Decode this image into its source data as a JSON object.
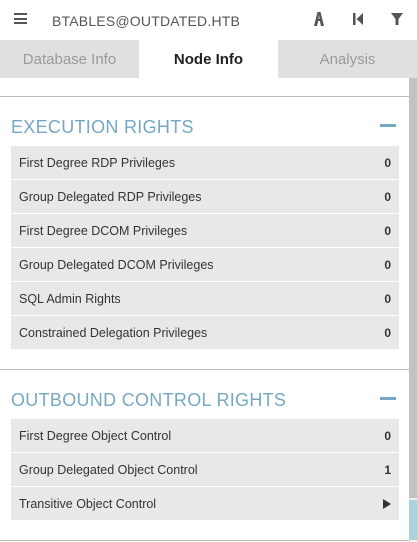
{
  "header": {
    "node_name": "BTABLES@OUTDATED.HTB",
    "icons": [
      "menu-icon",
      "pathfinding-icon",
      "back-icon",
      "filter-icon"
    ]
  },
  "tabs": [
    {
      "label": "Database Info",
      "active": false
    },
    {
      "label": "Node Info",
      "active": true
    },
    {
      "label": "Analysis",
      "active": false
    }
  ],
  "sections": [
    {
      "title": "EXECUTION RIGHTS",
      "rows": [
        {
          "label": "First Degree RDP Privileges",
          "value": "0"
        },
        {
          "label": "Group Delegated RDP Privileges",
          "value": "0"
        },
        {
          "label": "First Degree DCOM Privileges",
          "value": "0"
        },
        {
          "label": "Group Delegated DCOM Privileges",
          "value": "0"
        },
        {
          "label": "SQL Admin Rights",
          "value": "0"
        },
        {
          "label": "Constrained Delegation Privileges",
          "value": "0"
        }
      ]
    },
    {
      "title": "OUTBOUND CONTROL RIGHTS",
      "rows": [
        {
          "label": "First Degree Object Control",
          "value": "0"
        },
        {
          "label": "Group Delegated Object Control",
          "value": "1"
        },
        {
          "label": "Transitive Object Control",
          "value": "play-arrow-icon"
        }
      ]
    }
  ],
  "colors": {
    "section_title": "#76a8c4",
    "row_bg": "#e8e8e8",
    "tab_inactive_bg": "#e0e0e0"
  }
}
